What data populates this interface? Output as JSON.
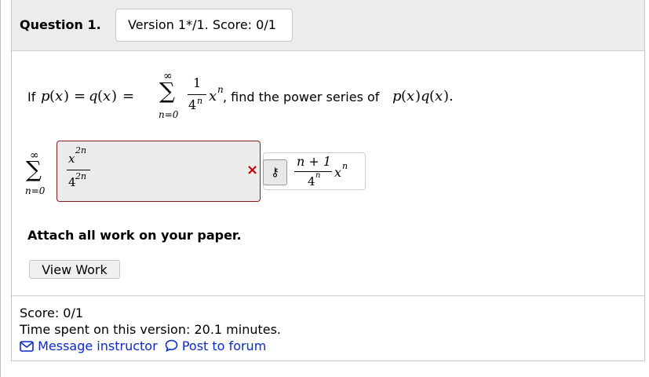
{
  "question": {
    "title": "Question 1.",
    "version_text": "Version 1*/1. Score: 0/1",
    "prefix": "If",
    "math": {
      "p": "p",
      "q": "q",
      "x": "x",
      "paren_open": "(",
      "paren_close": ")",
      "eq": "=",
      "sum": "∑",
      "inf": "∞",
      "lower": "n=0",
      "num": "1",
      "den": "4",
      "den_exp": "n",
      "xn": "x",
      "n": "n"
    },
    "suffix": ", find the power series of",
    "period": "."
  },
  "answer": {
    "sum": "∑",
    "upper": "∞",
    "lower": "n=0",
    "num_base": "x",
    "num_exp": "2n",
    "den_base": "4",
    "den_exp": "2n",
    "status_icon": "x-mark-icon",
    "status_mark": "×",
    "status_color": "#c00000"
  },
  "key": {
    "icon": "key-icon",
    "icon_glyph": "⚷",
    "num": "n + 1",
    "den_base": "4",
    "den_exp": "n",
    "x": "x",
    "x_exp": "n"
  },
  "attach_text": "Attach all work on your paper.",
  "view_work_label": "View Work",
  "footer": {
    "score": "Score: 0/1",
    "time_spent": "Time spent on this version: 20.1 minutes.",
    "message_label": "Message instructor",
    "forum_label": "Post to forum",
    "message_icon": "envelope-icon",
    "forum_icon": "chat-bubble-icon",
    "link_color": "#0b2ac9"
  }
}
